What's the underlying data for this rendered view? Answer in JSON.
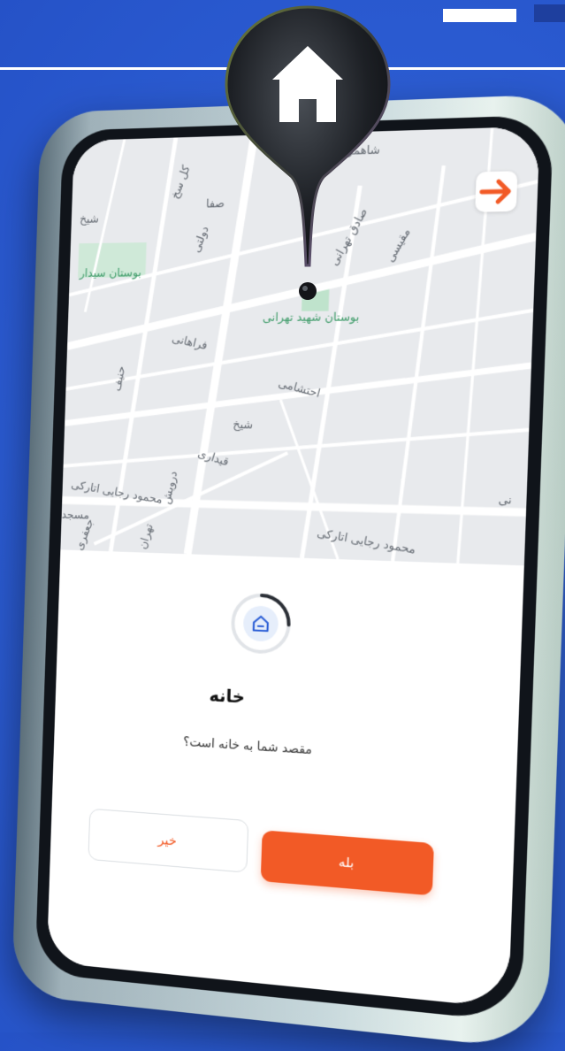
{
  "map": {
    "street_labels": [
      "شاهمرادی",
      "کل سخ",
      "صفا",
      "دولتی",
      "شیخ",
      "بوستان سیدار",
      "صادق تهرانی",
      "مقیسی",
      "بوستان شهید تهرانی",
      "فراهانی",
      "حنیف",
      "احتشامی",
      "شیخ",
      "قیداری",
      "درویش",
      "محمود رجایی اتارکی",
      "مسجد",
      "جعفری",
      "تهران",
      "محمود رجایی اتارکی",
      "نی"
    ]
  },
  "sheet": {
    "title": "خانه",
    "question": "مقصد شما به خانه است؟",
    "yes_label": "بله",
    "no_label": "خیر"
  },
  "colors": {
    "accent": "#f25a26",
    "background": "#2d5fd6",
    "icon_blue": "#2d5fd6"
  },
  "icons": {
    "pin": "home-pin-icon",
    "back": "arrow-right-icon",
    "home": "home-icon"
  }
}
